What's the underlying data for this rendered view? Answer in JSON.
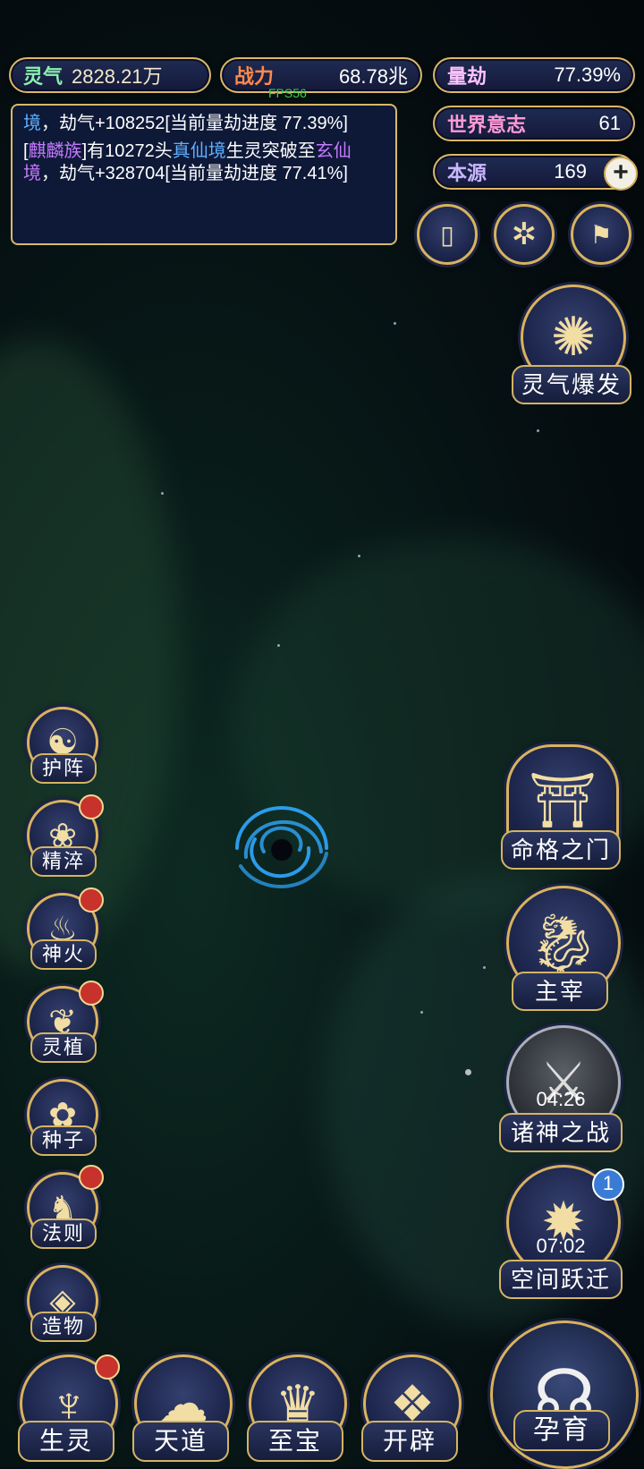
{
  "stats": {
    "lingqi": {
      "label": "灵气",
      "value": "2828.21万"
    },
    "zhanli": {
      "label": "战力",
      "value": "68.78兆"
    },
    "liangjie": {
      "label": "量劫",
      "value": "77.39%"
    },
    "shijie": {
      "label": "世界意志",
      "value": "61"
    },
    "benyuan": {
      "label": "本源",
      "value": "169"
    }
  },
  "fps": "FPS56",
  "log": {
    "line1_a": "境",
    "line1_b": "，劫气+108252[当前量劫进度 77.39%]",
    "line2_open": "[",
    "line2_race": "麒麟族",
    "line2_mid": "]有10272头",
    "line2_realm": "真仙境",
    "line2_after": "生灵突破至",
    "line2_realm2": "玄仙境",
    "line2_end": "，劫气+328704[当前量劫进度 77.41%]"
  },
  "right_buttons": {
    "burst": "灵气爆发",
    "fate_gate": "命格之门",
    "ruler": "主宰",
    "god_war": "诸神之战",
    "god_war_timer": "04:26",
    "space_jump": "空间跃迁",
    "space_jump_timer": "07:02",
    "space_jump_badge": "1",
    "nurture": "孕育"
  },
  "left_menu": [
    "护阵",
    "精淬",
    "神火",
    "灵植",
    "种子",
    "法则",
    "造物"
  ],
  "bottom_menu": [
    "生灵",
    "天道",
    "至宝",
    "开辟"
  ]
}
